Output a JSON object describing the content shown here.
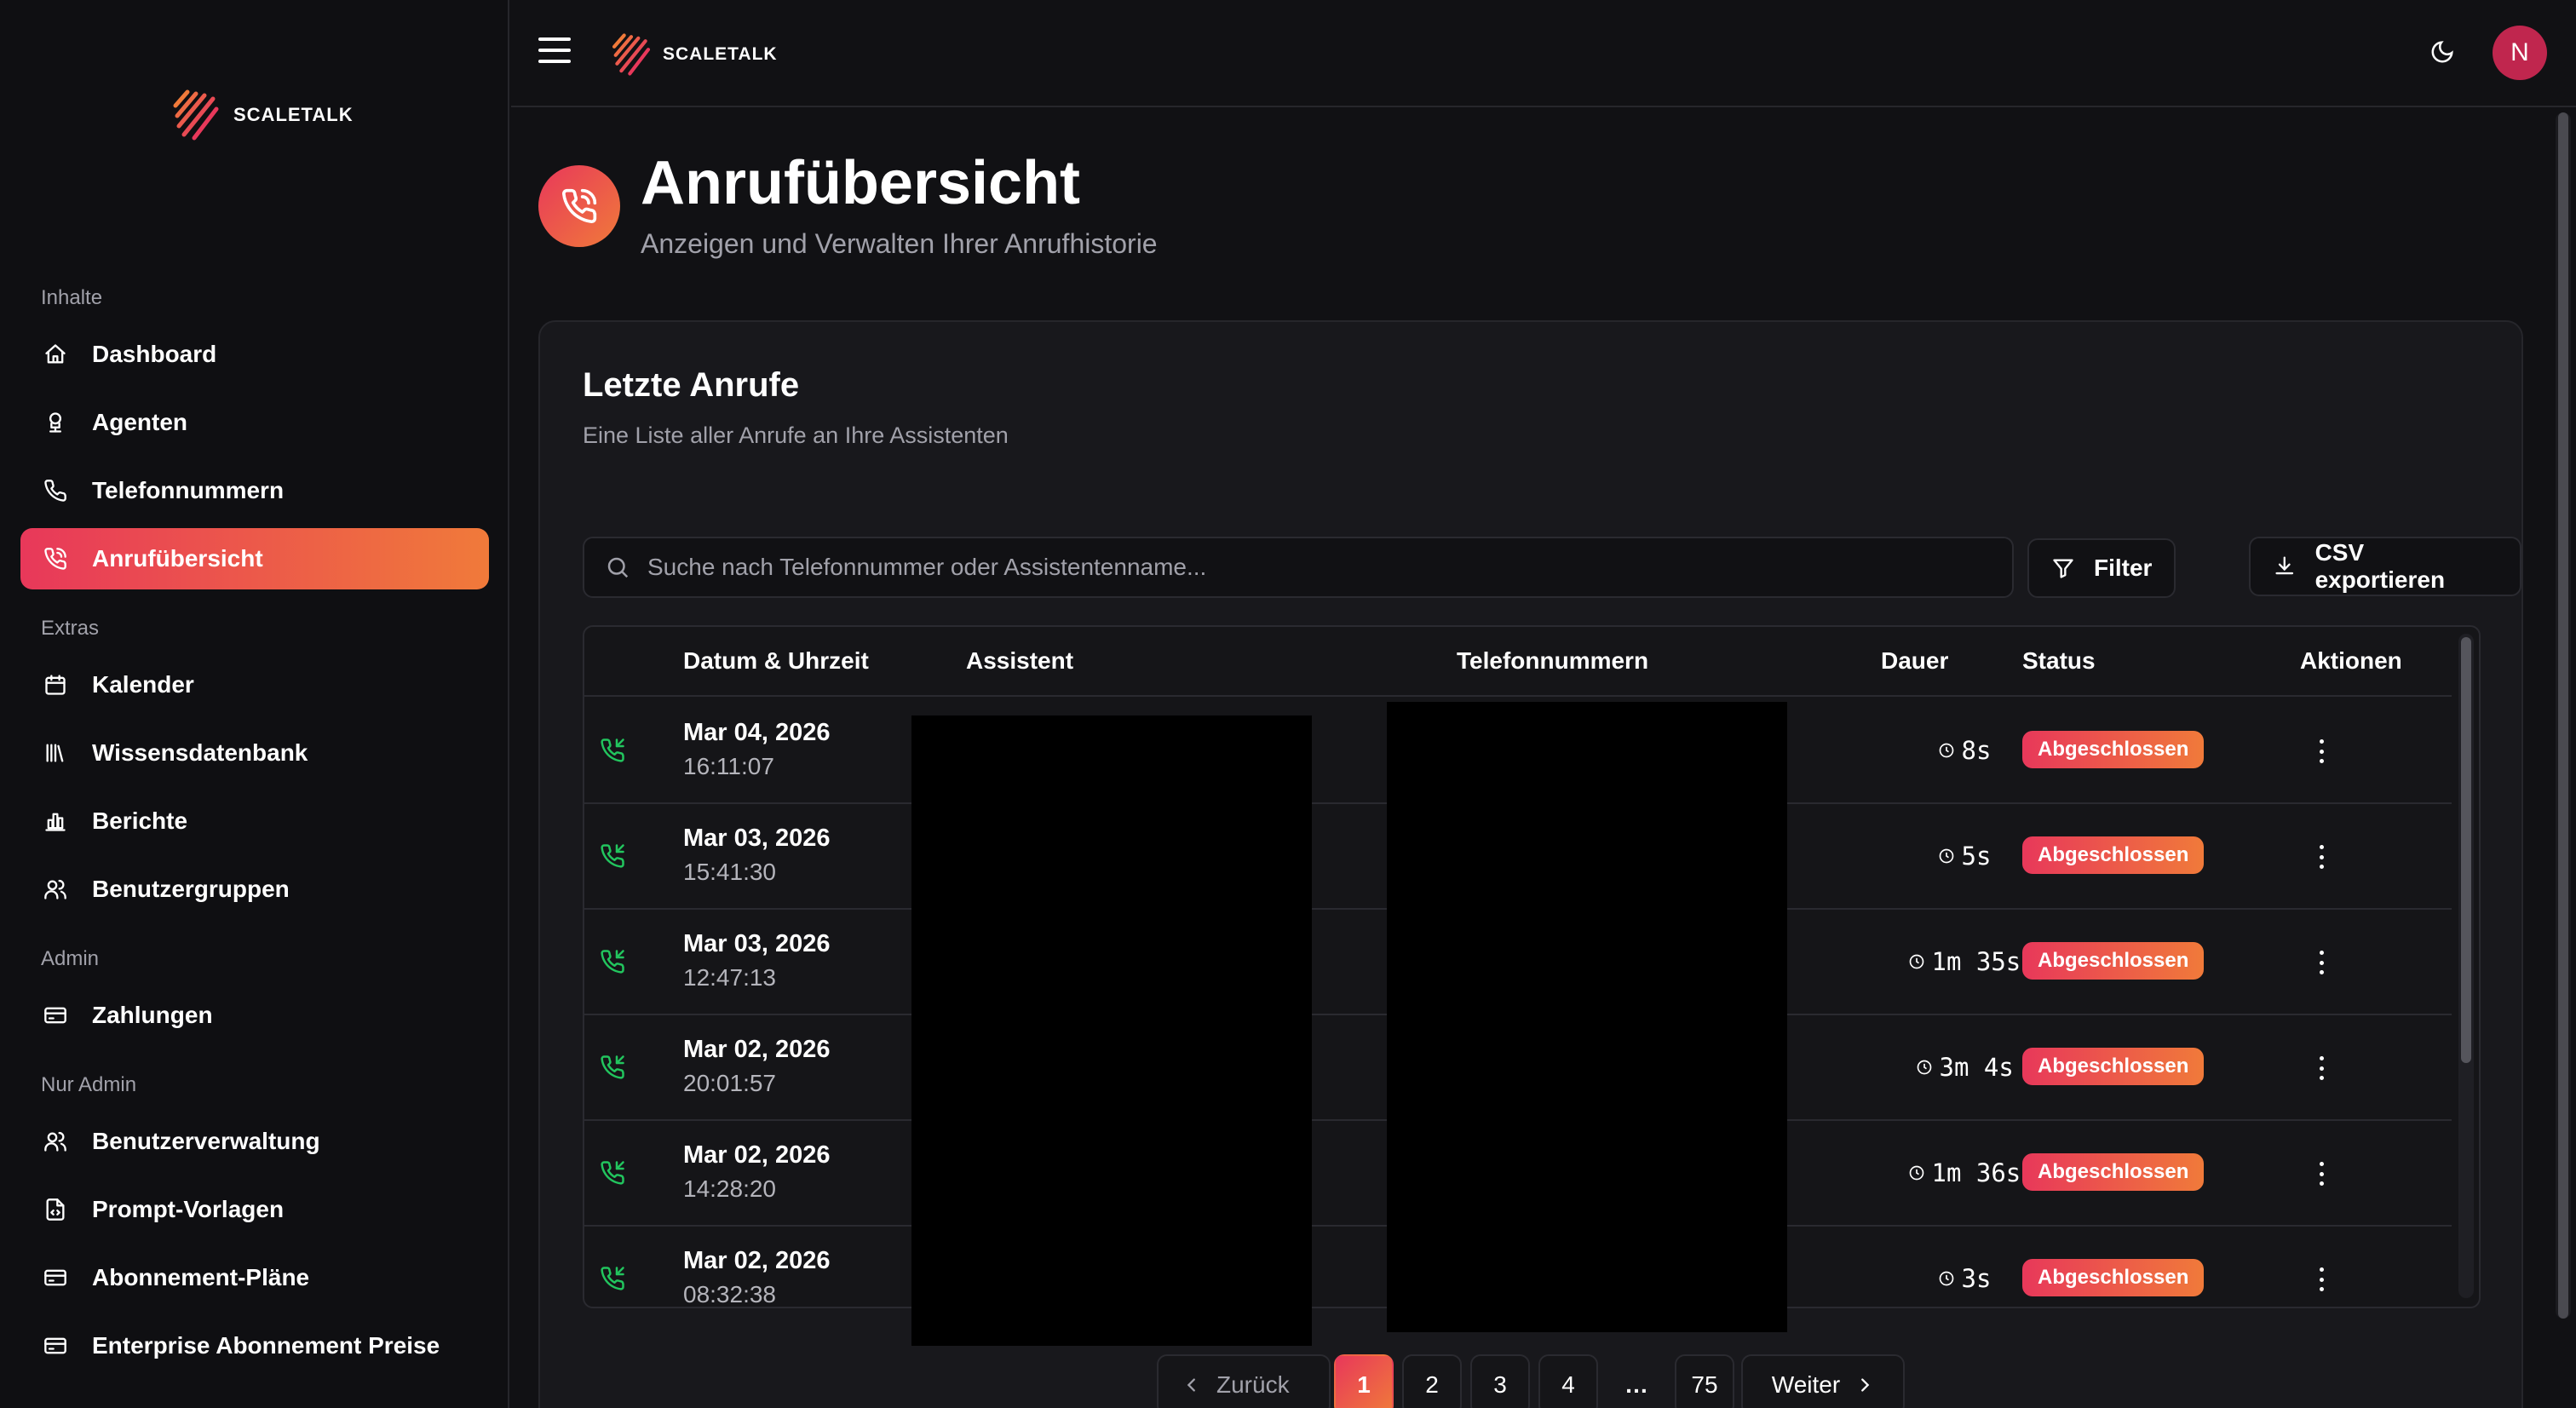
{
  "app": {
    "brand": "SCALETALK",
    "avatar_initial": "N"
  },
  "colors": {
    "accent_start": "#e8385a",
    "accent_end": "#f07a3a",
    "success_icon": "#22c55e",
    "background": "#111114"
  },
  "sidebar": {
    "sections": [
      {
        "label": "Inhalte",
        "items": [
          {
            "label": "Dashboard",
            "icon": "home-icon"
          },
          {
            "label": "Agenten",
            "icon": "bot-icon"
          },
          {
            "label": "Telefonnummern",
            "icon": "phone-icon"
          },
          {
            "label": "Anrufübersicht",
            "icon": "phone-call-icon",
            "active": true
          }
        ]
      },
      {
        "label": "Extras",
        "items": [
          {
            "label": "Kalender",
            "icon": "calendar-icon"
          },
          {
            "label": "Wissensdatenbank",
            "icon": "library-icon"
          },
          {
            "label": "Berichte",
            "icon": "bar-chart-icon"
          },
          {
            "label": "Benutzergruppen",
            "icon": "users-icon"
          }
        ]
      },
      {
        "label": "Admin",
        "items": [
          {
            "label": "Zahlungen",
            "icon": "credit-card-icon"
          }
        ]
      },
      {
        "label": "Nur Admin",
        "items": [
          {
            "label": "Benutzerverwaltung",
            "icon": "users-icon"
          },
          {
            "label": "Prompt-Vorlagen",
            "icon": "file-code-icon"
          },
          {
            "label": "Abonnement-Pläne",
            "icon": "credit-card-icon"
          },
          {
            "label": "Enterprise Abonnement Preise",
            "icon": "credit-card-icon"
          }
        ]
      }
    ]
  },
  "page": {
    "title": "Anrufübersicht",
    "subtitle": "Anzeigen und Verwalten Ihrer Anrufhistorie"
  },
  "card": {
    "title": "Letzte Anrufe",
    "subtitle": "Eine Liste aller Anrufe an Ihre Assistenten",
    "search_placeholder": "Suche nach Telefonnummer oder Assistentenname...",
    "filter_label": "Filter",
    "export_label": "CSV exportieren"
  },
  "table": {
    "columns": {
      "datetime": "Datum & Uhrzeit",
      "assistant": "Assistent",
      "phone": "Telefonnummern",
      "duration": "Dauer",
      "status": "Status",
      "actions": "Aktionen"
    },
    "rows": [
      {
        "date": "Mar 04, 2026",
        "time": "16:11:07",
        "duration": "8s",
        "status": "Abgeschlossen"
      },
      {
        "date": "Mar 03, 2026",
        "time": "15:41:30",
        "duration": "5s",
        "status": "Abgeschlossen"
      },
      {
        "date": "Mar 03, 2026",
        "time": "12:47:13",
        "duration": "1m 35s",
        "status": "Abgeschlossen"
      },
      {
        "date": "Mar 02, 2026",
        "time": "20:01:57",
        "duration": "3m 4s",
        "status": "Abgeschlossen"
      },
      {
        "date": "Mar 02, 2026",
        "time": "14:28:20",
        "duration": "1m 36s",
        "status": "Abgeschlossen"
      },
      {
        "date": "Mar 02, 2026",
        "time": "08:32:38",
        "duration": "3s",
        "status": "Abgeschlossen"
      }
    ]
  },
  "pagination": {
    "prev": "Zurück",
    "next": "Weiter",
    "pages": [
      "1",
      "2",
      "3",
      "4"
    ],
    "ellipsis": "…",
    "last": "75",
    "current": "1"
  }
}
